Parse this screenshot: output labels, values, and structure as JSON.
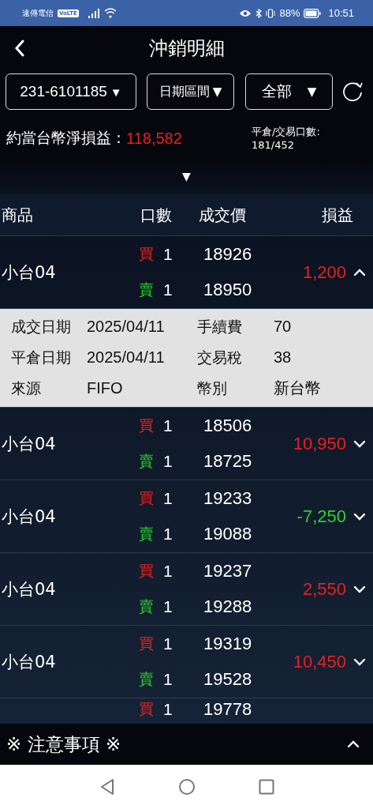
{
  "status_bar": {
    "carrier": "遠傳電信",
    "network_badge": "VoLTE",
    "battery": "88%",
    "time": "10:51"
  },
  "header": {
    "title": "沖銷明細"
  },
  "filters": [
    {
      "label": "231-6101185",
      "arrow": "▼"
    },
    {
      "label": "日期區間",
      "arrow": "▼"
    },
    {
      "label": "全部",
      "arrow": "▼"
    }
  ],
  "summary": {
    "label": "約當台幣淨損益：",
    "value": "118,582",
    "count_label": "平倉/交易口數:",
    "count_value": "181/452",
    "toggle": "▼"
  },
  "table": {
    "columns": [
      "商品",
      "口數",
      "成交價",
      "損益"
    ],
    "rows": [
      {
        "product": "小台04",
        "buy_side": "買",
        "buy_qty": "1",
        "buy_price": "18926",
        "sell_side": "賣",
        "sell_qty": "1",
        "sell_price": "18950",
        "pnl": "1,200",
        "color": "#e8201e",
        "expanded": true,
        "details": [
          {
            "label": "成交日期",
            "value": "2025/04/11",
            "label2": "手續費",
            "value2": "70"
          },
          {
            "label": "平倉日期",
            "value": "2025/04/11",
            "label2": "交易稅",
            "value2": "38"
          },
          {
            "label": "來源",
            "value": "FIFO",
            "label2": "幣別",
            "value2": "新台幣"
          }
        ]
      },
      {
        "product": "小台04",
        "buy_side": "買",
        "buy_qty": "1",
        "buy_price": "18506",
        "sell_side": "賣",
        "sell_qty": "1",
        "sell_price": "18725",
        "pnl": "10,950",
        "color": "#e8201e",
        "expanded": false
      },
      {
        "product": "小台04",
        "buy_side": "買",
        "buy_qty": "1",
        "buy_price": "19233",
        "sell_side": "賣",
        "sell_qty": "1",
        "sell_price": "19088",
        "pnl": "-7,250",
        "color": "#2fd12f",
        "expanded": false
      },
      {
        "product": "小台04",
        "buy_side": "買",
        "buy_qty": "1",
        "buy_price": "19237",
        "sell_side": "賣",
        "sell_qty": "1",
        "sell_price": "19288",
        "pnl": "2,550",
        "color": "#e8201e",
        "expanded": false
      },
      {
        "product": "小台04",
        "buy_side": "買",
        "buy_qty": "1",
        "buy_price": "19319",
        "sell_side": "賣",
        "sell_qty": "1",
        "sell_price": "19528",
        "pnl": "10,450",
        "color": "#e8201e",
        "expanded": false
      },
      {
        "buy_side": "買",
        "buy_qty": "1",
        "buy_price": "19778"
      }
    ]
  },
  "notice": {
    "title": "※ 注意事項 ※",
    "expanded": false
  }
}
